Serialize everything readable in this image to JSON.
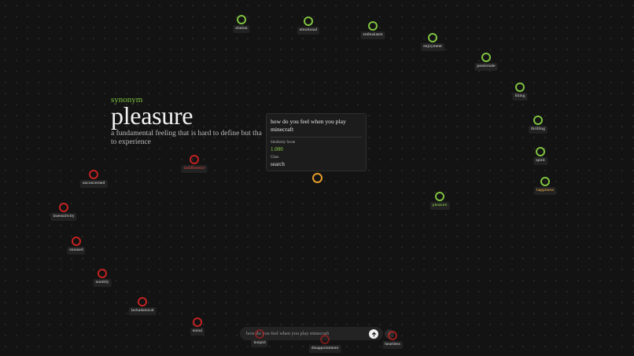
{
  "info": {
    "kind": "synonym",
    "word": "pleasure",
    "description": "a fundamental feeling that is hard to define but tha to experience"
  },
  "tooltip": {
    "query": "how do you feel when you play minecraft",
    "score_label": "Similarity Score",
    "score_value": "1.000",
    "class_label": "Class",
    "class_value": "search"
  },
  "search": {
    "value": "how do you feel when you play minecraft",
    "submit_icon": "arrow-up-icon",
    "mini_label": "i"
  },
  "nodes": {
    "elation": "elation",
    "emotional": "emotional",
    "enthusiasm": "enthusiasm",
    "enjoyment": "enjoyment",
    "passionate": "passionate",
    "liking": "liking",
    "thrilling": "thrilling",
    "spirit": "spirit",
    "happiness": "happiness",
    "pleasure": "pleasure",
    "indifference": "indifference",
    "unconcerned": "unconcerned",
    "insensitivity": "insensitivity",
    "stunned": "stunned",
    "numbly": "numbly",
    "lackadaisical": "lackadaisical",
    "ennui": "ennui",
    "insipid": "insipid",
    "disappointment": "disappointment",
    "heartless": "heartless"
  },
  "colors": {
    "synonym": "#7fc241",
    "antonym": "#c22222",
    "query": "#e39a2a",
    "background": "#131313"
  }
}
